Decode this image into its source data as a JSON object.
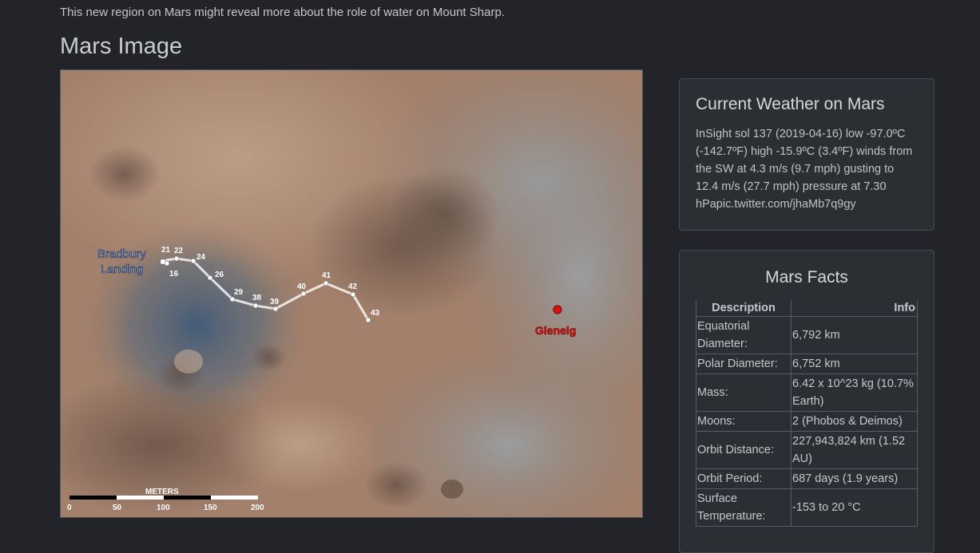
{
  "teaser": "This new region on Mars might reveal more about the role of water on Mount Sharp.",
  "section_title": "Mars Image",
  "map": {
    "landing_label_1": "Bradbury",
    "landing_label_2": "Landing",
    "target_label": "Glenelg",
    "scale_title": "METERS",
    "scale_ticks": [
      "0",
      "50",
      "100",
      "150",
      "200"
    ],
    "sol_labels": [
      "21",
      "22",
      "24",
      "16",
      "26",
      "29",
      "38",
      "39",
      "40",
      "41",
      "42",
      "43"
    ]
  },
  "weather": {
    "title": "Current Weather on Mars",
    "text": "InSight sol 137 (2019-04-16) low -97.0ºC (-142.7ºF) high -15.9ºC (3.4ºF) winds from the SW at 4.3 m/s (9.7 mph) gusting to 12.4 m/s (27.7 mph) pressure at 7.30 hPapic.twitter.com/jhaMb7q9gy"
  },
  "facts": {
    "title": "Mars Facts",
    "col_description": "Description",
    "col_info": "Info",
    "rows": [
      {
        "k": "Equatorial Diameter:",
        "v": "6,792 km"
      },
      {
        "k": "Polar Diameter:",
        "v": "6,752 km"
      },
      {
        "k": "Mass:",
        "v": "6.42 x 10^23 kg (10.7% Earth)"
      },
      {
        "k": "Moons:",
        "v": "2 (Phobos & Deimos)"
      },
      {
        "k": "Orbit Distance:",
        "v": "227,943,824 km (1.52 AU)"
      },
      {
        "k": "Orbit Period:",
        "v": "687 days (1.9 years)"
      },
      {
        "k": "Surface Temperature:",
        "v": "-153 to 20 °C"
      }
    ]
  },
  "colors": {
    "page_bg": "#222429",
    "card_bg": "#2b2e33",
    "landing_label": "#7fb0ff",
    "target_marker": "#e01010"
  }
}
